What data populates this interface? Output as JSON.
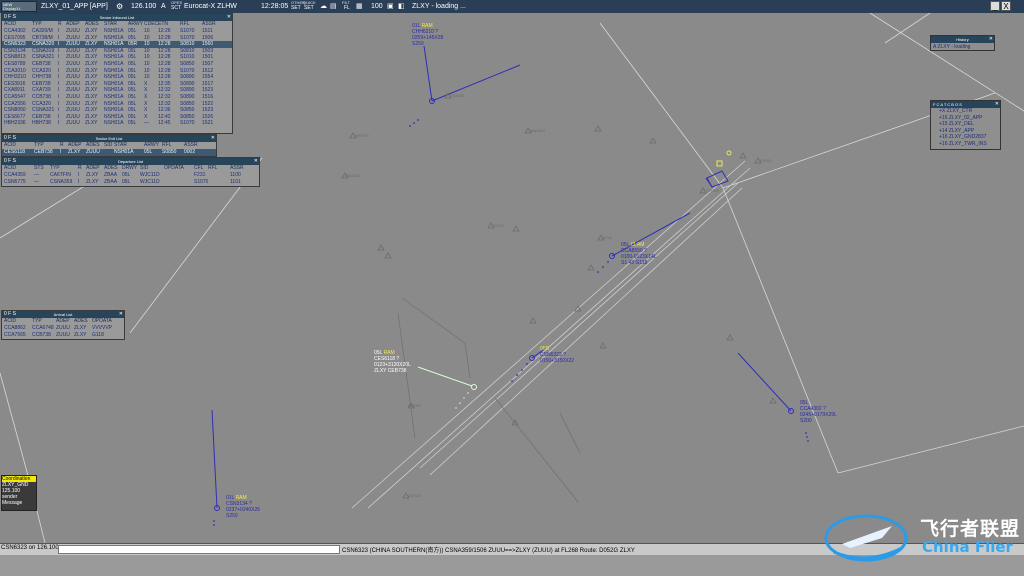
{
  "topbar": {
    "logo_label": "NEW",
    "logo_sub": "DisplayXL",
    "session": "ZLXY_01_APP [APP]",
    "frequency": "126.100",
    "freq_flag": "A",
    "opes_top": "OPES",
    "opes_bottom": "SCT",
    "sector_name": "Eurocat-X ZLHW",
    "clock": "12:28:05",
    "other_top": "OTHER",
    "other_mid": "QUICK",
    "set1": "SET",
    "set2": "SET",
    "filt_top": "FILT",
    "filt_bottom": "FL",
    "range": "100",
    "status": "ZLXY - loading ...",
    "min_btn": "_",
    "close_btn": "X"
  },
  "sector_inbound": {
    "title": "Sector Inbound List",
    "controls": "0 F S",
    "headers": [
      "ACID",
      "TYP",
      "R",
      "ADEP",
      "ADES",
      "STAR",
      "ARWY",
      "CDEC",
      "ETN",
      "RFL",
      "ASSR"
    ],
    "rows": [
      [
        "CCA4302",
        "CA320/M",
        "I",
        "ZUUU",
        "ZLXY",
        "NSH01A",
        "05L",
        "10",
        "12:26",
        "S1070",
        "1511"
      ],
      [
        "CES7095",
        "CB738/M",
        "I",
        "ZUUU",
        "ZLXY",
        "NSH01A",
        "05L",
        "10",
        "12:28",
        "S1070",
        "1506"
      ],
      [
        "CSN6323",
        "CSNA320",
        "I",
        "ZUUU",
        "ZLXY",
        "NSH01A",
        "05R",
        "10",
        "12:28",
        "S0810",
        "1560"
      ],
      [
        "CSN3134",
        "CSNA319",
        "I",
        "ZUUU",
        "ZLXY",
        "NSH01A",
        "05L",
        "10",
        "12:28",
        "S0810",
        "1503"
      ],
      [
        "CSN8813",
        "CSNA321",
        "I",
        "ZUUU",
        "ZLXY",
        "NSH01A",
        "05L",
        "10",
        "12:28",
        "S1010",
        "1501"
      ],
      [
        "CES8789",
        "CEB738",
        "I",
        "ZUUU",
        "ZLXY",
        "NSH01A",
        "05L",
        "10",
        "12:28",
        "S0850",
        "1507"
      ],
      [
        "CCA3010",
        "CCA320",
        "I",
        "ZUUU",
        "ZLXY",
        "NSH01A",
        "05L",
        "10",
        "12:28",
        "S1070",
        "1512"
      ],
      [
        "CHH3210",
        "CHH738",
        "I",
        "ZUUU",
        "ZLXY",
        "NSH01A",
        "05L",
        "10",
        "12:28",
        "S0890",
        "1554"
      ],
      [
        "CES3916",
        "CEB738",
        "I",
        "ZUUU",
        "ZLXY",
        "NSH01A",
        "05L",
        "X",
        "12:35",
        "S0890",
        "1517"
      ],
      [
        "CXA8911",
        "CXA739",
        "I",
        "ZUUU",
        "ZLXY",
        "NSH01A",
        "05L",
        "X",
        "12:32",
        "S0890",
        "1523"
      ],
      [
        "CCA5547",
        "CCB738",
        "I",
        "ZUUU",
        "ZLXY",
        "NSH01A",
        "05L",
        "X",
        "12:32",
        "S0890",
        "1516"
      ],
      [
        "CCA2556",
        "CCA320",
        "I",
        "ZUUU",
        "ZLXY",
        "NSH01A",
        "05L",
        "X",
        "12:32",
        "S0850",
        "1522"
      ],
      [
        "CSN8050",
        "CSNA321",
        "I",
        "ZUUU",
        "ZLXY",
        "NSH01A",
        "05L",
        "X",
        "12:36",
        "S0850",
        "1523"
      ],
      [
        "CES6677",
        "CEB738",
        "I",
        "ZUUU",
        "ZLXY",
        "NSH01A",
        "05L",
        "X",
        "12:42",
        "S0850",
        "1526"
      ],
      [
        "HBH2336",
        "HBH738",
        "I",
        "ZUUU",
        "ZLXY",
        "NSH01A",
        "05L",
        "—",
        "12:45",
        "S1070",
        "1521"
      ]
    ]
  },
  "sector_exit": {
    "title": "Sector Exit List",
    "controls": "0 F S",
    "headers": [
      "ACID",
      "TYP",
      "R",
      "ADEP",
      "ADES",
      "SID",
      "STAR",
      "ARWY",
      "RFL",
      "ASSR"
    ],
    "rows": [
      [
        "CES6118",
        "CEB738",
        "I",
        "ZLXY",
        "ZUUU",
        "",
        "NSH01A",
        "05L",
        "S0850",
        "0002"
      ]
    ]
  },
  "departure": {
    "title": "Departure List",
    "controls": "0 F S",
    "headers": [
      "ACID",
      "STS",
      "TYP",
      "R",
      "ADEP",
      "ADES",
      "DRWY",
      "SID",
      "OPDATA",
      "CFL",
      "RFL",
      "ASSR"
    ],
    "rows": [
      [
        "CCA4359",
        "—",
        "CA6TFIN",
        "I",
        "ZLXY",
        "ZBAA",
        "05L",
        "WJC11D",
        "",
        "F231",
        "",
        "1100"
      ],
      [
        "CSN6775",
        "—",
        "CSNA359",
        "I",
        "ZLXY",
        "ZBAA",
        "05L",
        "WJC11D",
        "",
        "S1070",
        "",
        "1101"
      ]
    ]
  },
  "arrival": {
    "title": "Arrival List",
    "controls": "0 F S",
    "headers": [
      "ACID",
      "TYP",
      "ADEP",
      "ADES",
      "OPDATA"
    ],
    "rows": [
      [
        "CCA8862",
        "CCA6748",
        "ZUUU",
        "ZLXY",
        "VVVVVP"
      ],
      [
        "CCA7565",
        "CCB738",
        "ZUUU",
        "ZLXY",
        "G118"
      ]
    ]
  },
  "history": {
    "title": "History",
    "line": "A ZLXY - loading"
  },
  "atc_list": {
    "controls": "F C A T C B O S",
    "items": [
      "+X  ZLXY_CTR",
      "+16 ZLXY_02_APP",
      "+15 ZLXY_DEL",
      "+14 ZLXY_APP",
      "+16 ZLXY_GND2837",
      "+16 ZLXY_TWR_INS"
    ]
  },
  "coordination": {
    "title": "Coordination",
    "l2": "ZLXY_GND",
    "l3": "125.100",
    "l4": "sender",
    "l5": "Message"
  },
  "tracks": [
    {
      "id": "chh",
      "l1": "01L",
      "l1b": "RAM",
      "l2": "CHH6210  ?",
      "l3": "0259+145X28",
      "l4": "S250"
    },
    {
      "id": "top",
      "l1": "05L",
      "l1b": "CLAM",
      "l2": "CCA8550  ?",
      "l3": "0100-0123X14L",
      "l4": "S1 43  G118"
    },
    {
      "id": "csn6323",
      "l1": "05R",
      "l1b": "",
      "l2": "CSN6323  ?",
      "l3": "0150+3150X22",
      "l4": ""
    },
    {
      "id": "ces6118",
      "l1": "05L",
      "l1b": "RAM",
      "l2": "CES6118  ?",
      "l3": "0123+3120X20L",
      "l4": "ZLXY  CEB738"
    },
    {
      "id": "cca4302",
      "l1": "05L",
      "l1b": "",
      "l2": "CCA4302  ?",
      "l3": "0245+0179X29L",
      "l4": "S200"
    },
    {
      "id": "csn3134",
      "l1": "01L",
      "l1b": "RAM",
      "l2": "CSN3134  ?",
      "l3": "0237+0240X26",
      "l4": "S250"
    }
  ],
  "cmdline": {
    "prefix": "CSN6323 on 126.100",
    "info": "CSN6323 (CHINA SOUTHERN(南方)) CSNA359/1506 ZUUU==>ZLXY (ZUUU) at FL268 Route: D052G ZLXY"
  },
  "watermark": {
    "cn": "飞行者联盟",
    "en": "China Flier"
  },
  "colors": {
    "scope": "#8a8a8a",
    "panel_title": "#27455a",
    "track_blue": "#2a2aa8",
    "highlight_yellow": "#f2e84c"
  }
}
